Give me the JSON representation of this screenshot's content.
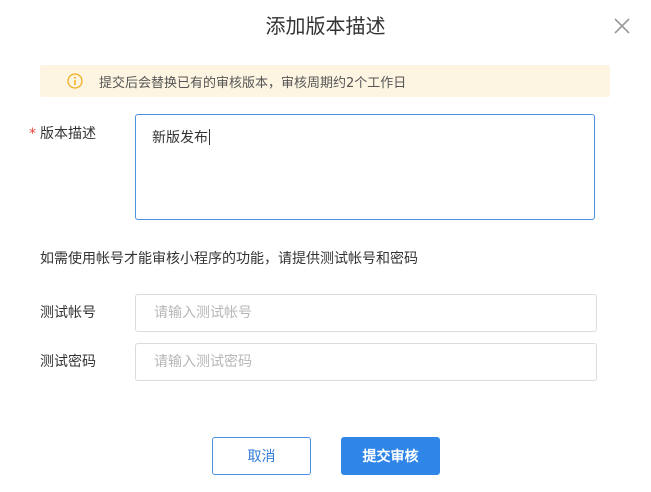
{
  "dialog": {
    "title": "添加版本描述",
    "close_icon": "close-icon"
  },
  "notice": {
    "icon": "info-icon",
    "icon_color": "#f0ad1e",
    "background": "#fdf5e2",
    "text": "提交后会替换已有的审核版本，审核周期约2个工作日"
  },
  "form": {
    "description": {
      "required_mark": "*",
      "label": "版本描述",
      "value": "新版发布"
    },
    "hint": "如需使用帐号才能审核小程序的功能，请提供测试帐号和密码",
    "test_account": {
      "label": "测试帐号",
      "placeholder": "请输入测试帐号"
    },
    "test_password": {
      "label": "测试密码",
      "placeholder": "请输入测试密码"
    }
  },
  "actions": {
    "cancel_label": "取消",
    "submit_label": "提交审核",
    "primary_color": "#2f86e8"
  }
}
